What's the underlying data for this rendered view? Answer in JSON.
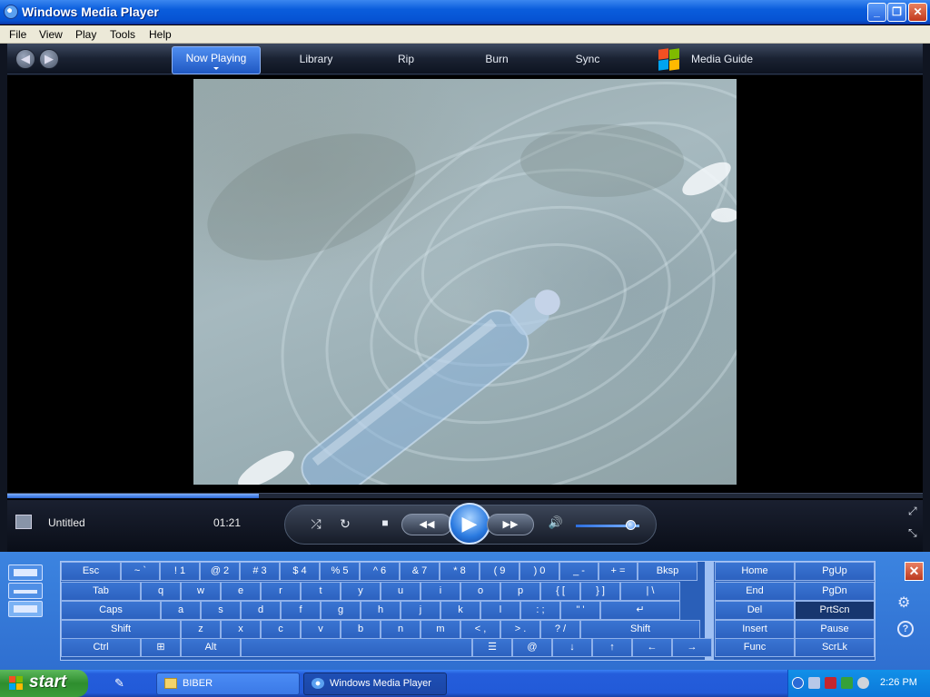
{
  "window": {
    "title": "Windows Media Player",
    "controls": {
      "minimize": "_",
      "maximize": "❐",
      "close": "✕"
    }
  },
  "menu": {
    "items": [
      "File",
      "View",
      "Play",
      "Tools",
      "Help"
    ]
  },
  "wmp": {
    "nav": {
      "back": "◀",
      "forward": "▶"
    },
    "tabs": {
      "now_playing": "Now Playing",
      "library": "Library",
      "rip": "Rip",
      "burn": "Burn",
      "sync": "Sync",
      "media_guide": "Media Guide"
    },
    "track": {
      "title": "Untitled",
      "time": "01:21"
    },
    "seek_progress": 0.275,
    "volume_level": 0.85,
    "transport": {
      "shuffle": "⤮",
      "repeat": "↻",
      "stop": "■",
      "rewind": "◀◀",
      "play": "▶",
      "fast_forward": "▶▶",
      "mute": "🔊"
    },
    "corner": {
      "full_mode": "⤢",
      "compact_mode": "⤡"
    }
  },
  "keyboard": {
    "rows": [
      [
        "Esc",
        "~ `",
        "! 1",
        "@ 2",
        "# 3",
        "$ 4",
        "% 5",
        "^ 6",
        "& 7",
        "* 8",
        "( 9",
        ") 0",
        "_ -",
        "+ =",
        "Bksp"
      ],
      [
        "Tab",
        "q",
        "w",
        "e",
        "r",
        "t",
        "y",
        "u",
        "i",
        "o",
        "p",
        "{ [",
        "} ]",
        "| \\"
      ],
      [
        "Caps",
        "a",
        "s",
        "d",
        "f",
        "g",
        "h",
        "j",
        "k",
        "l",
        ": ;",
        "\" '",
        "↵"
      ],
      [
        "Shift",
        "z",
        "x",
        "c",
        "v",
        "b",
        "n",
        "m",
        "< ,",
        "> .",
        "? /",
        "Shift"
      ],
      [
        "Ctrl",
        "⊞",
        "Alt",
        "",
        "☰",
        "@",
        "↓",
        "↑",
        "←",
        "→"
      ]
    ],
    "nav_keys": [
      [
        "Home",
        "PgUp"
      ],
      [
        "End",
        "PgDn"
      ],
      [
        "Del",
        "PrtScn"
      ],
      [
        "Insert",
        "Pause"
      ],
      [
        "Func",
        "ScrLk"
      ]
    ],
    "close": "✕",
    "settings_icon": "⚙",
    "help_icon": "?"
  },
  "taskbar": {
    "start": "start",
    "buttons": [
      {
        "label": "BIBER",
        "active": false
      },
      {
        "label": "Windows Media Player",
        "active": true
      }
    ],
    "clock": "2:26 PM"
  }
}
